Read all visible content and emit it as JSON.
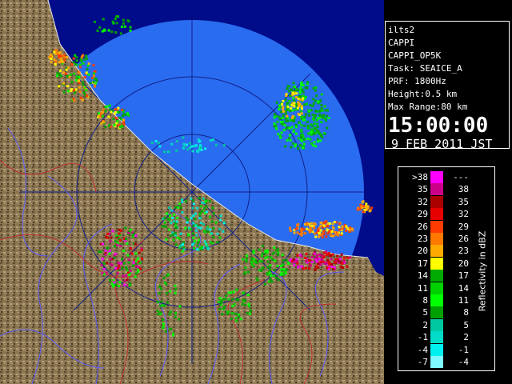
{
  "info": {
    "station": "ilts2",
    "product": "CAPPI",
    "product_id": "CAPPI_OP5K",
    "task": "Task: SEAICE_A",
    "prf": "PRF: 1800Hz",
    "height": "Height:0.5 km",
    "max_range": "Max Range:80 km",
    "time": "15:00:00",
    "date": "9 FEB 2011 JST"
  },
  "legend": {
    "units_label": "Reflectivity in dBZ",
    "rows": [
      {
        "lo": ">38",
        "hi": "---",
        "color": "#ff00ff"
      },
      {
        "lo": "35",
        "hi": "38",
        "color": "#cc0088"
      },
      {
        "lo": "32",
        "hi": "35",
        "color": "#aa0000"
      },
      {
        "lo": "29",
        "hi": "32",
        "color": "#e60000"
      },
      {
        "lo": "26",
        "hi": "29",
        "color": "#ff3c00"
      },
      {
        "lo": "23",
        "hi": "26",
        "color": "#ff7800"
      },
      {
        "lo": "20",
        "hi": "23",
        "color": "#ffaa00"
      },
      {
        "lo": "17",
        "hi": "20",
        "color": "#ffff00"
      },
      {
        "lo": "14",
        "hi": "17",
        "color": "#00aa00"
      },
      {
        "lo": "11",
        "hi": "14",
        "color": "#00d200"
      },
      {
        "lo": "8",
        "hi": "11",
        "color": "#00ff00"
      },
      {
        "lo": "5",
        "hi": "8",
        "color": "#00a000"
      },
      {
        "lo": "2",
        "hi": "5",
        "color": "#00c8a0"
      },
      {
        "lo": "-1",
        "hi": "2",
        "color": "#00dcc8"
      },
      {
        "lo": "-4",
        "hi": "-1",
        "color": "#00f0f0"
      },
      {
        "lo": "-7",
        "hi": "-4",
        "color": "#7df9ff"
      }
    ]
  },
  "colors": {
    "sea": "#2a6cf0",
    "outside_range": "#000c8a",
    "land": "#8a7650",
    "rivers": "#5a5aff",
    "borders": "#c03030"
  }
}
